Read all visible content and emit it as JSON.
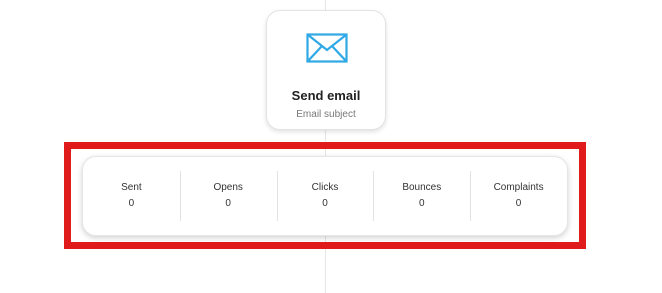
{
  "node": {
    "icon": "envelope-icon",
    "icon_color": "#2fa8e6",
    "title": "Send email",
    "subtitle": "Email subject"
  },
  "highlight": {
    "color": "#e01b1b"
  },
  "stats": [
    {
      "label": "Sent",
      "value": "0"
    },
    {
      "label": "Opens",
      "value": "0"
    },
    {
      "label": "Clicks",
      "value": "0"
    },
    {
      "label": "Bounces",
      "value": "0"
    },
    {
      "label": "Complaints",
      "value": "0"
    }
  ]
}
